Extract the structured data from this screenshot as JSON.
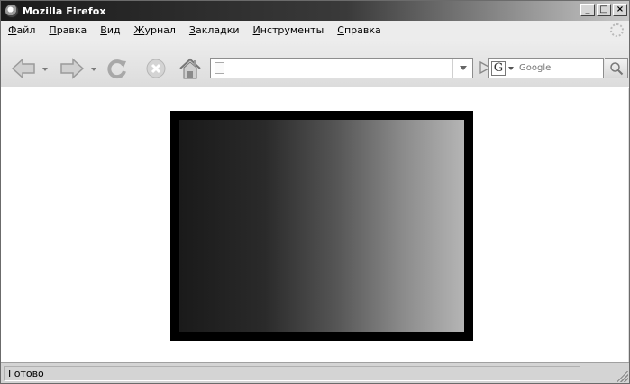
{
  "window": {
    "title": "Mozilla Firefox",
    "controls": {
      "minimize": "_",
      "maximize": "□",
      "close": "×"
    }
  },
  "menubar": {
    "items": [
      {
        "before": "",
        "acc": "Ф",
        "after": "айл"
      },
      {
        "before": "",
        "acc": "П",
        "after": "равка"
      },
      {
        "before": "",
        "acc": "В",
        "after": "ид"
      },
      {
        "before": "",
        "acc": "Ж",
        "after": "урнал"
      },
      {
        "before": "",
        "acc": "З",
        "after": "акладки"
      },
      {
        "before": "",
        "acc": "И",
        "after": "нструменты"
      },
      {
        "before": "",
        "acc": "С",
        "after": "правка"
      }
    ]
  },
  "toolbar": {
    "icons": [
      "back-arrow-icon",
      "forward-arrow-icon",
      "reload-icon",
      "stop-icon",
      "home-icon"
    ],
    "url": {
      "value": "",
      "placeholder": ""
    },
    "search": {
      "engine": "G",
      "placeholder": "Google"
    }
  },
  "content": {
    "box_gradient": [
      "#1a1a1a",
      "#b5b5b5"
    ],
    "border_color": "#000000"
  },
  "statusbar": {
    "text": "Готово"
  }
}
